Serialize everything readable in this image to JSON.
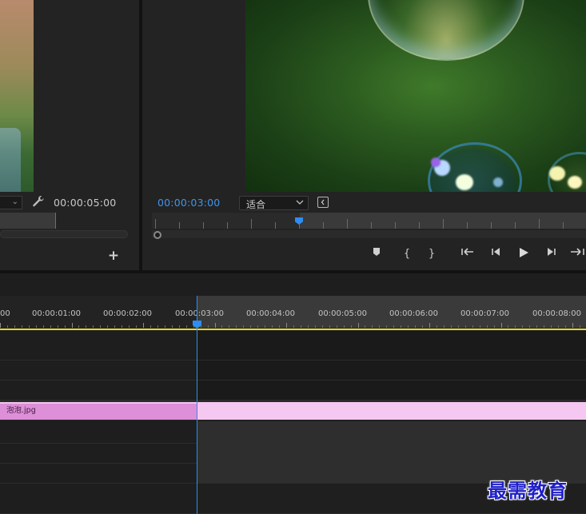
{
  "source_monitor": {
    "timecode": "00:00:05:00",
    "dropdown_chevron": "⌄",
    "icons": {
      "settings": "wrench-icon",
      "add": "plus-icon"
    }
  },
  "program_monitor": {
    "timecode": "00:00:03:00",
    "fit_select": {
      "selected": "适合"
    },
    "transport_icons": [
      "marker-icon",
      "mark-in-icon",
      "mark-out-icon",
      "go-to-in-icon",
      "step-back-icon",
      "play-icon",
      "step-forward-icon",
      "go-to-out-icon"
    ]
  },
  "timeline": {
    "ruler_labels": [
      "00",
      "00:00:01:00",
      "00:00:02:00",
      "00:00:03:00",
      "00:00:04:00",
      "00:00:05:00",
      "00:00:06:00",
      "00:00:07:00",
      "00:00:08:00"
    ],
    "clip": {
      "name": "泡泡.jpg",
      "color": "#dd8fd8"
    },
    "playhead_timecode_seconds": 3
  },
  "colors": {
    "accent_blue": "#2f8cf0",
    "work_area_yellow": "#e8d629",
    "clip_pink": "#dd8fd8"
  },
  "watermark": {
    "text": "最需教育"
  }
}
